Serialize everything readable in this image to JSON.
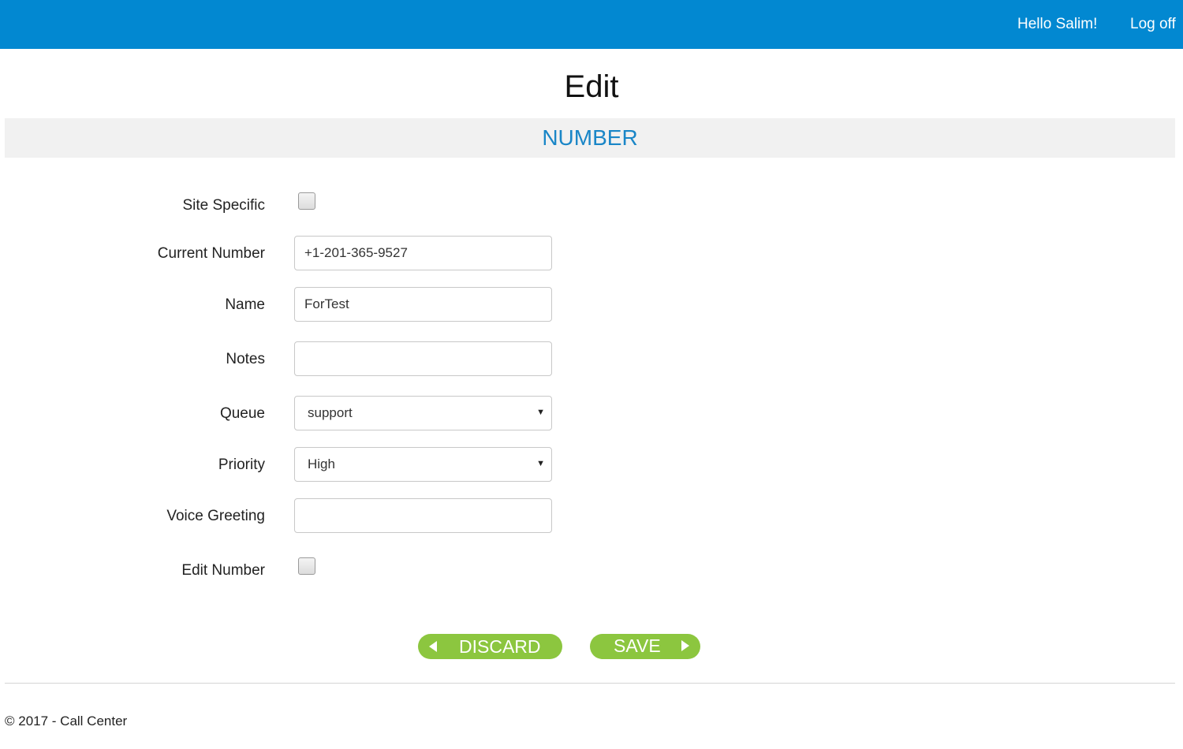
{
  "header": {
    "greeting": "Hello Salim!",
    "logoff_label": "Log off",
    "background_color": "#0288d1"
  },
  "page_title": "Edit",
  "section_title": "NUMBER",
  "form": {
    "site_specific": {
      "label": "Site Specific",
      "checked": false
    },
    "current_number": {
      "label": "Current Number",
      "value": "+1-201-365-9527"
    },
    "name": {
      "label": "Name",
      "value": "ForTest"
    },
    "notes": {
      "label": "Notes",
      "value": ""
    },
    "queue": {
      "label": "Queue",
      "value": "support"
    },
    "priority": {
      "label": "Priority",
      "value": "High"
    },
    "voice_greeting": {
      "label": "Voice Greeting",
      "value": ""
    },
    "edit_number": {
      "label": "Edit Number",
      "checked": false
    }
  },
  "actions": {
    "discard_label": "DISCARD",
    "save_label": "SAVE",
    "button_color": "#8cc63f"
  },
  "footer": {
    "text": "© 2017 - Call Center"
  }
}
